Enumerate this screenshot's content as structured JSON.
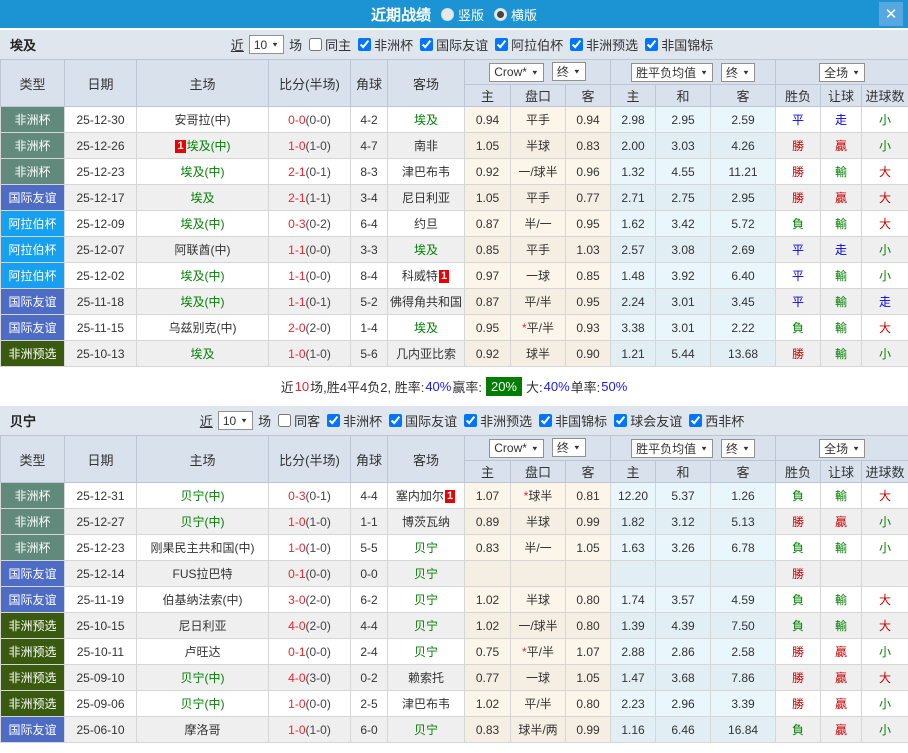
{
  "titlebar": {
    "title": "近期战绩",
    "radios": [
      {
        "label": "竖版",
        "checked": false
      },
      {
        "label": "横版",
        "checked": true
      }
    ],
    "close": "✕"
  },
  "filter": {
    "prefix": "近",
    "matches": "10",
    "suffix": "场"
  },
  "table_header": {
    "left_cols": [
      "类型",
      "日期",
      "主场",
      "比分(半场)",
      "角球",
      "客场"
    ],
    "groups": [
      {
        "selects": [
          "Crow*",
          "终"
        ],
        "sub": [
          "主",
          "盘口",
          "客"
        ]
      },
      {
        "selects": [
          "胜平负均值",
          "终"
        ],
        "sub": [
          "主",
          "和",
          "客"
        ]
      },
      {
        "selects": [
          "全场"
        ],
        "sub": [
          "胜负",
          "让球",
          "进球数"
        ]
      }
    ]
  },
  "type_colors": {
    "非洲杯": "#618a7c",
    "国际友谊": "#4f6cc4",
    "阿拉伯杯": "#18a0f0",
    "非洲预选": "#3a5b0f"
  },
  "result_colors": {
    "勝": "#cc0000",
    "贏": "#cc0000",
    "大": "#cc0000",
    "負": "#008000",
    "輸": "#008000",
    "小": "#008000",
    "平": "#0000e8",
    "走": "#0000e8"
  },
  "sections": [
    {
      "team": "埃及",
      "same_label": "同主",
      "same_checked": false,
      "competitions": [
        {
          "label": "非洲杯",
          "checked": true
        },
        {
          "label": "国际友谊",
          "checked": true
        },
        {
          "label": "阿拉伯杯",
          "checked": true
        },
        {
          "label": "非洲预选",
          "checked": true
        },
        {
          "label": "非国锦标",
          "checked": true
        }
      ],
      "rows": [
        {
          "type": "非洲杯",
          "date": "25-12-30",
          "home": "安哥拉(中)",
          "home_focus": false,
          "home_badge": "",
          "score": "0-0",
          "half": "(0-0)",
          "corner": "4-2",
          "away": "埃及",
          "away_focus": true,
          "away_badge": "",
          "odds": [
            "0.94",
            "平手",
            "0.94"
          ],
          "avg": [
            "2.98",
            "2.95",
            "2.59"
          ],
          "results": [
            "平",
            "走",
            "小"
          ]
        },
        {
          "type": "非洲杯",
          "date": "25-12-26",
          "home": "埃及(中)",
          "home_focus": true,
          "home_badge": "1",
          "score": "1-0",
          "half": "(1-0)",
          "corner": "4-7",
          "away": "南非",
          "away_focus": false,
          "away_badge": "",
          "odds": [
            "1.05",
            "半球",
            "0.83"
          ],
          "avg": [
            "2.00",
            "3.03",
            "4.26"
          ],
          "results": [
            "勝",
            "贏",
            "小"
          ]
        },
        {
          "type": "非洲杯",
          "date": "25-12-23",
          "home": "埃及(中)",
          "home_focus": true,
          "home_badge": "",
          "score": "2-1",
          "half": "(0-1)",
          "corner": "8-3",
          "away": "津巴布韦",
          "away_focus": false,
          "away_badge": "",
          "odds": [
            "0.92",
            "一/球半",
            "0.96"
          ],
          "avg": [
            "1.32",
            "4.55",
            "11.21"
          ],
          "results": [
            "勝",
            "輸",
            "大"
          ]
        },
        {
          "type": "国际友谊",
          "date": "25-12-17",
          "home": "埃及",
          "home_focus": true,
          "home_badge": "",
          "score": "2-1",
          "half": "(1-1)",
          "corner": "3-4",
          "away": "尼日利亚",
          "away_focus": false,
          "away_badge": "",
          "odds": [
            "1.05",
            "平手",
            "0.77"
          ],
          "avg": [
            "2.71",
            "2.75",
            "2.95"
          ],
          "results": [
            "勝",
            "贏",
            "大"
          ]
        },
        {
          "type": "阿拉伯杯",
          "date": "25-12-09",
          "home": "埃及(中)",
          "home_focus": true,
          "home_badge": "",
          "score": "0-3",
          "half": "(0-2)",
          "corner": "6-4",
          "away": "约旦",
          "away_focus": false,
          "away_badge": "",
          "odds": [
            "0.87",
            "半/一",
            "0.95"
          ],
          "avg": [
            "1.62",
            "3.42",
            "5.72"
          ],
          "results": [
            "負",
            "輸",
            "大"
          ]
        },
        {
          "type": "阿拉伯杯",
          "date": "25-12-07",
          "home": "阿联酋(中)",
          "home_focus": false,
          "home_badge": "",
          "score": "1-1",
          "half": "(0-0)",
          "corner": "3-3",
          "away": "埃及",
          "away_focus": true,
          "away_badge": "",
          "odds": [
            "0.85",
            "平手",
            "1.03"
          ],
          "avg": [
            "2.57",
            "3.08",
            "2.69"
          ],
          "results": [
            "平",
            "走",
            "小"
          ]
        },
        {
          "type": "阿拉伯杯",
          "date": "25-12-02",
          "home": "埃及(中)",
          "home_focus": true,
          "home_badge": "",
          "score": "1-1",
          "half": "(0-0)",
          "corner": "8-4",
          "away": "科威特",
          "away_focus": false,
          "away_badge": "1",
          "odds": [
            "0.97",
            "一球",
            "0.85"
          ],
          "avg": [
            "1.48",
            "3.92",
            "6.40"
          ],
          "results": [
            "平",
            "輸",
            "小"
          ]
        },
        {
          "type": "国际友谊",
          "date": "25-11-18",
          "home": "埃及(中)",
          "home_focus": true,
          "home_badge": "",
          "score": "1-1",
          "half": "(0-1)",
          "corner": "5-2",
          "away": "佛得角共和国",
          "away_focus": false,
          "away_badge": "",
          "odds": [
            "0.87",
            "平/半",
            "0.95"
          ],
          "avg": [
            "2.24",
            "3.01",
            "3.45"
          ],
          "results": [
            "平",
            "輸",
            "走"
          ]
        },
        {
          "type": "国际友谊",
          "date": "25-11-15",
          "home": "乌兹别克(中)",
          "home_focus": false,
          "home_badge": "",
          "score": "2-0",
          "half": "(2-0)",
          "corner": "1-4",
          "away": "埃及",
          "away_focus": true,
          "away_badge": "",
          "odds": [
            "0.95",
            "*平/半",
            "0.93"
          ],
          "avg": [
            "3.38",
            "3.01",
            "2.22"
          ],
          "results": [
            "負",
            "輸",
            "大"
          ]
        },
        {
          "type": "非洲预选",
          "date": "25-10-13",
          "home": "埃及",
          "home_focus": true,
          "home_badge": "",
          "score": "1-0",
          "half": "(1-0)",
          "corner": "5-6",
          "away": "几内亚比索",
          "away_focus": false,
          "away_badge": "",
          "odds": [
            "0.92",
            "球半",
            "0.90"
          ],
          "avg": [
            "1.21",
            "5.44",
            "13.68"
          ],
          "results": [
            "勝",
            "輸",
            "小"
          ]
        }
      ],
      "summary": [
        {
          "t": "近",
          "s": "p"
        },
        {
          "t": "10",
          "s": "r"
        },
        {
          "t": "场,胜4平4负2, 胜率:",
          "s": "p"
        },
        {
          "t": "40%",
          "s": "b"
        },
        {
          "t": " 赢率:",
          "s": "p"
        },
        {
          "t": "20%",
          "s": "chip"
        },
        {
          "t": "大:",
          "s": "p"
        },
        {
          "t": "40%",
          "s": "b"
        },
        {
          "t": " 单率:",
          "s": "p"
        },
        {
          "t": "50%",
          "s": "b"
        }
      ]
    },
    {
      "team": "贝宁",
      "same_label": "同客",
      "same_checked": false,
      "competitions": [
        {
          "label": "非洲杯",
          "checked": true
        },
        {
          "label": "国际友谊",
          "checked": true
        },
        {
          "label": "非洲预选",
          "checked": true
        },
        {
          "label": "非国锦标",
          "checked": true
        },
        {
          "label": "球会友谊",
          "checked": true
        },
        {
          "label": "西非杯",
          "checked": true
        }
      ],
      "rows": [
        {
          "type": "非洲杯",
          "date": "25-12-31",
          "home": "贝宁(中)",
          "home_focus": true,
          "home_badge": "",
          "score": "0-3",
          "half": "(0-1)",
          "corner": "4-4",
          "away": "塞内加尔",
          "away_focus": false,
          "away_badge": "1",
          "odds": [
            "1.07",
            "*球半",
            "0.81"
          ],
          "avg": [
            "12.20",
            "5.37",
            "1.26"
          ],
          "results": [
            "負",
            "輸",
            "大"
          ]
        },
        {
          "type": "非洲杯",
          "date": "25-12-27",
          "home": "贝宁(中)",
          "home_focus": true,
          "home_badge": "",
          "score": "1-0",
          "half": "(1-0)",
          "corner": "1-1",
          "away": "博茨瓦纳",
          "away_focus": false,
          "away_badge": "",
          "odds": [
            "0.89",
            "半球",
            "0.99"
          ],
          "avg": [
            "1.82",
            "3.12",
            "5.13"
          ],
          "results": [
            "勝",
            "贏",
            "小"
          ]
        },
        {
          "type": "非洲杯",
          "date": "25-12-23",
          "home": "刚果民主共和国(中)",
          "home_focus": false,
          "home_badge": "",
          "score": "1-0",
          "half": "(1-0)",
          "corner": "5-5",
          "away": "贝宁",
          "away_focus": true,
          "away_badge": "",
          "odds": [
            "0.83",
            "半/一",
            "1.05"
          ],
          "avg": [
            "1.63",
            "3.26",
            "6.78"
          ],
          "results": [
            "負",
            "輸",
            "小"
          ]
        },
        {
          "type": "国际友谊",
          "date": "25-12-14",
          "home": "FUS拉巴特",
          "home_focus": false,
          "home_badge": "",
          "score": "0-1",
          "half": "(0-0)",
          "corner": "0-0",
          "away": "贝宁",
          "away_focus": true,
          "away_badge": "",
          "odds": [
            "",
            "",
            ""
          ],
          "avg": [
            "",
            "",
            ""
          ],
          "results": [
            "勝",
            "",
            ""
          ]
        },
        {
          "type": "国际友谊",
          "date": "25-11-19",
          "home": "伯基纳法索(中)",
          "home_focus": false,
          "home_badge": "",
          "score": "3-0",
          "half": "(2-0)",
          "corner": "6-2",
          "away": "贝宁",
          "away_focus": true,
          "away_badge": "",
          "odds": [
            "1.02",
            "半球",
            "0.80"
          ],
          "avg": [
            "1.74",
            "3.57",
            "4.59"
          ],
          "results": [
            "負",
            "輸",
            "大"
          ]
        },
        {
          "type": "非洲预选",
          "date": "25-10-15",
          "home": "尼日利亚",
          "home_focus": false,
          "home_badge": "",
          "score": "4-0",
          "half": "(2-0)",
          "corner": "4-4",
          "away": "贝宁",
          "away_focus": true,
          "away_badge": "",
          "odds": [
            "1.02",
            "一/球半",
            "0.80"
          ],
          "avg": [
            "1.39",
            "4.39",
            "7.50"
          ],
          "results": [
            "負",
            "輸",
            "大"
          ]
        },
        {
          "type": "非洲预选",
          "date": "25-10-11",
          "home": "卢旺达",
          "home_focus": false,
          "home_badge": "",
          "score": "0-1",
          "half": "(0-0)",
          "corner": "2-4",
          "away": "贝宁",
          "away_focus": true,
          "away_badge": "",
          "odds": [
            "0.75",
            "*平/半",
            "1.07"
          ],
          "avg": [
            "2.88",
            "2.86",
            "2.58"
          ],
          "results": [
            "勝",
            "贏",
            "小"
          ]
        },
        {
          "type": "非洲预选",
          "date": "25-09-10",
          "home": "贝宁(中)",
          "home_focus": true,
          "home_badge": "",
          "score": "4-0",
          "half": "(3-0)",
          "corner": "0-2",
          "away": "赖索托",
          "away_focus": false,
          "away_badge": "",
          "odds": [
            "0.77",
            "一球",
            "1.05"
          ],
          "avg": [
            "1.47",
            "3.68",
            "7.86"
          ],
          "results": [
            "勝",
            "贏",
            "大"
          ]
        },
        {
          "type": "非洲预选",
          "date": "25-09-06",
          "home": "贝宁(中)",
          "home_focus": true,
          "home_badge": "",
          "score": "1-0",
          "half": "(0-0)",
          "corner": "2-5",
          "away": "津巴布韦",
          "away_focus": false,
          "away_badge": "",
          "odds": [
            "1.02",
            "平/半",
            "0.80"
          ],
          "avg": [
            "2.23",
            "2.96",
            "3.39"
          ],
          "results": [
            "勝",
            "贏",
            "小"
          ]
        },
        {
          "type": "国际友谊",
          "date": "25-06-10",
          "home": "摩洛哥",
          "home_focus": false,
          "home_badge": "",
          "score": "1-0",
          "half": "(1-0)",
          "corner": "6-0",
          "away": "贝宁",
          "away_focus": true,
          "away_badge": "",
          "odds": [
            "0.83",
            "球半/两",
            "0.99"
          ],
          "avg": [
            "1.16",
            "6.46",
            "16.84"
          ],
          "results": [
            "負",
            "贏",
            "小"
          ]
        }
      ],
      "summary": null
    }
  ]
}
